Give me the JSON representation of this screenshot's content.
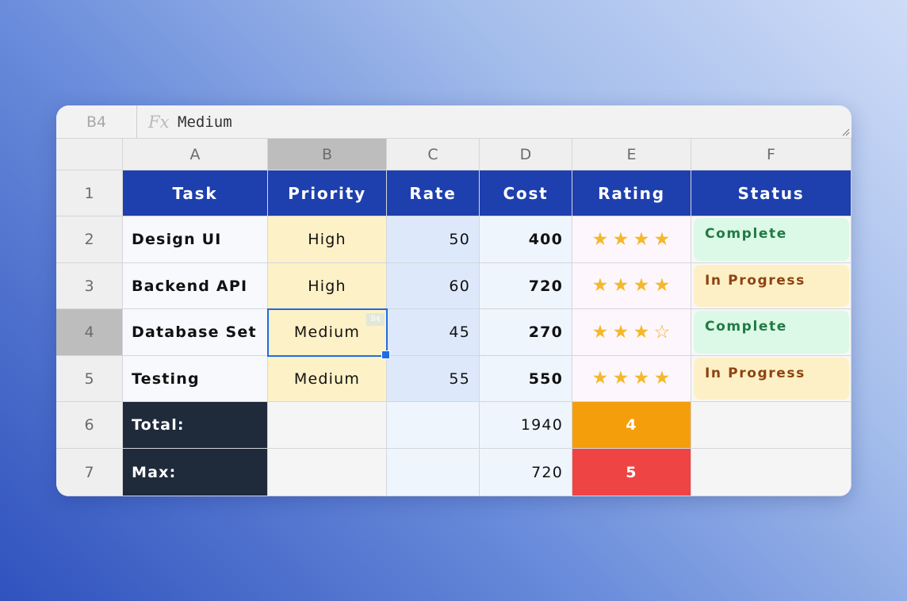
{
  "formula_bar": {
    "cell_ref": "B4",
    "fx_label": "Fx",
    "formula": "Medium"
  },
  "columns": [
    "A",
    "B",
    "C",
    "D",
    "E",
    "F"
  ],
  "rows": [
    "1",
    "2",
    "3",
    "4",
    "5",
    "6",
    "7"
  ],
  "selected_cell": {
    "column": "B",
    "row": "4",
    "tag": "B4"
  },
  "header": {
    "task": "Task",
    "priority": "Priority",
    "rate": "Rate",
    "cost": "Cost",
    "rating": "Rating",
    "status": "Status"
  },
  "tasks": [
    {
      "task": "Design UI",
      "priority": "High",
      "rate": "50",
      "cost": "400",
      "rating": 4,
      "status": "Complete",
      "status_kind": "complete"
    },
    {
      "task": "Backend API",
      "priority": "High",
      "rate": "60",
      "cost": "720",
      "rating": 4,
      "status": "In Progress",
      "status_kind": "progress"
    },
    {
      "task": "Database Set",
      "priority": "Medium",
      "rate": "45",
      "cost": "270",
      "rating": 3,
      "status": "Complete",
      "status_kind": "complete"
    },
    {
      "task": "Testing",
      "priority": "Medium",
      "rate": "55",
      "cost": "550",
      "rating": 4,
      "status": "In Progress",
      "status_kind": "progress"
    }
  ],
  "rating_max": 4,
  "summary": {
    "total_label": "Total:",
    "total_cost": "1940",
    "total_rating": "4",
    "max_label": "Max:",
    "max_cost": "720",
    "max_rating": "5"
  },
  "colors": {
    "header_bg": "#1e3fae",
    "complete_text": "#217a45",
    "progress_text": "#8e4312",
    "star": "#f5b82b",
    "total_bg": "#f59e0c",
    "max_bg": "#ef4444",
    "selection": "#1e6ce6"
  }
}
